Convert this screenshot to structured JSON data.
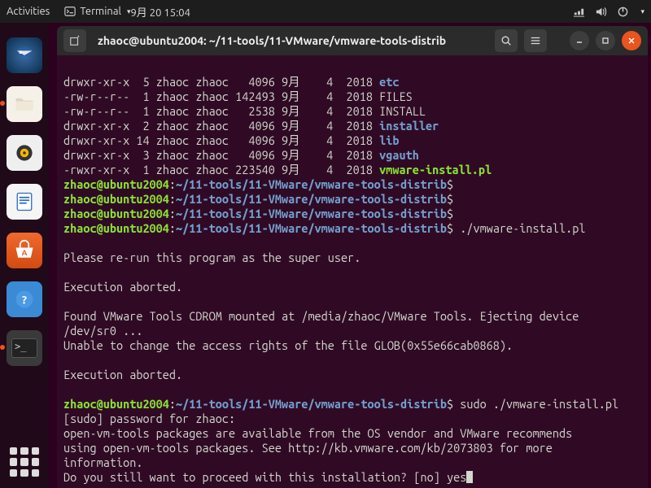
{
  "topbar": {
    "activities": "Activities",
    "app_indicator": "Terminal",
    "clock": "9月 20  15:04"
  },
  "window": {
    "title": "zhaoc@ubuntu2004: ~/11-tools/11-VMware/vmware-tools-distrib"
  },
  "listing": [
    {
      "perm": "drwxr-xr-x",
      "links": "5",
      "user": "zhaoc",
      "group": "zhaoc",
      "size": "4096",
      "month": "9月",
      "day": "4",
      "year": "2018",
      "name": "etc",
      "kind": "dir"
    },
    {
      "perm": "-rw-r--r--",
      "links": "1",
      "user": "zhaoc",
      "group": "zhaoc",
      "size": "142493",
      "month": "9月",
      "day": "4",
      "year": "2018",
      "name": "FILES",
      "kind": "file"
    },
    {
      "perm": "-rw-r--r--",
      "links": "1",
      "user": "zhaoc",
      "group": "zhaoc",
      "size": "2538",
      "month": "9月",
      "day": "4",
      "year": "2018",
      "name": "INSTALL",
      "kind": "file"
    },
    {
      "perm": "drwxr-xr-x",
      "links": "2",
      "user": "zhaoc",
      "group": "zhaoc",
      "size": "4096",
      "month": "9月",
      "day": "4",
      "year": "2018",
      "name": "installer",
      "kind": "dir"
    },
    {
      "perm": "drwxr-xr-x",
      "links": "14",
      "user": "zhaoc",
      "group": "zhaoc",
      "size": "4096",
      "month": "9月",
      "day": "4",
      "year": "2018",
      "name": "lib",
      "kind": "dir"
    },
    {
      "perm": "drwxr-xr-x",
      "links": "3",
      "user": "zhaoc",
      "group": "zhaoc",
      "size": "4096",
      "month": "9月",
      "day": "4",
      "year": "2018",
      "name": "vgauth",
      "kind": "dir"
    },
    {
      "perm": "-rwxr-xr-x",
      "links": "1",
      "user": "zhaoc",
      "group": "zhaoc",
      "size": "223540",
      "month": "9月",
      "day": "4",
      "year": "2018",
      "name": "vmware-install.pl",
      "kind": "exec"
    }
  ],
  "prompt": {
    "user_host": "zhaoc@ubuntu2004",
    "path": "~/11-tools/11-VMware/vmware-tools-distrib",
    "symbol": "$"
  },
  "commands": {
    "cmd1": "./vmware-install.pl",
    "cmd2": "sudo ./vmware-install.pl"
  },
  "output": {
    "rerun": "Please re-run this program as the super user.",
    "aborted": "Execution aborted.",
    "found1": "Found VMware Tools CDROM mounted at /media/zhaoc/VMware Tools. Ejecting device",
    "found2": "/dev/sr0 ...",
    "unable": "Unable to change the access rights of the file GLOB(0x55e66cab0868).",
    "sudo_prompt": "[sudo] password for zhaoc:",
    "ovt1": "open-vm-tools packages are available from the OS vendor and VMware recommends",
    "ovt2": "using open-vm-tools packages. See http://kb.vmware.com/kb/2073803 for more",
    "ovt3": "information.",
    "proceed": "Do you still want to proceed with this installation? [no] yes"
  }
}
